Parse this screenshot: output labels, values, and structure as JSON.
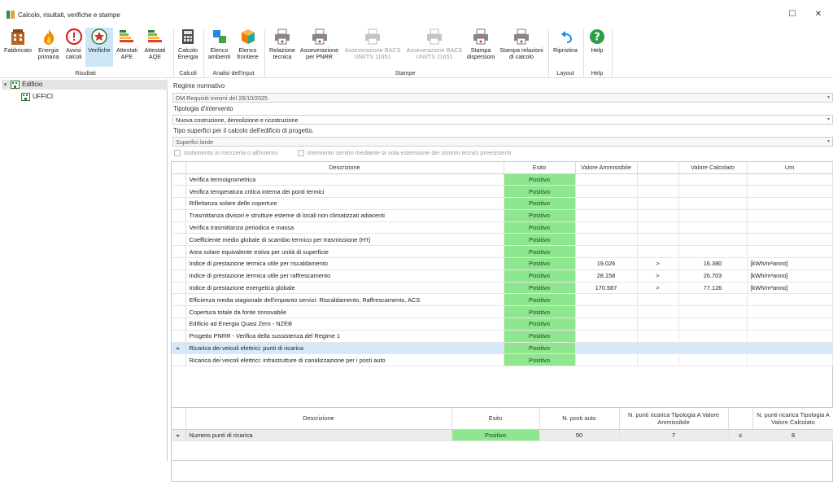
{
  "window": {
    "title": "Calcolo, risultati, verifiche e stampe",
    "minimize_glyph": "☐",
    "close_glyph": "✕"
  },
  "ribbon": {
    "buttons": [
      {
        "label": "Fabbricato",
        "icon": "building-icon"
      },
      {
        "label": "Energia primaria",
        "icon": "fire-icon"
      },
      {
        "label": "Avvisi calcoli",
        "icon": "warning-icon"
      },
      {
        "label": "Verifiche",
        "icon": "emblem-icon"
      },
      {
        "label": "Attestati APE",
        "icon": "energy-class-icon"
      },
      {
        "label": "Attestati AQE",
        "icon": "energy-class-icon"
      },
      {
        "label": "Calcolo Energia",
        "icon": "calculator-icon"
      },
      {
        "label": "Elenco ambienti",
        "icon": "rooms-icon"
      },
      {
        "label": "Elenco frontiere",
        "icon": "cube-icon"
      },
      {
        "label": "Relazione tecnica",
        "icon": "printer-icon"
      },
      {
        "label": "Asseverazione per PNRR",
        "icon": "printer-icon"
      },
      {
        "label": "Asseverazione BACS UNI/TS 11651",
        "icon": "printer-icon"
      },
      {
        "label": "Asseverazione BACS UNI/TS 11651",
        "icon": "printer-icon"
      },
      {
        "label": "Stampa dispersioni",
        "icon": "printer-icon"
      },
      {
        "label": "Stampa relazioni di calcolo",
        "icon": "printer-icon"
      },
      {
        "label": "Ripristina",
        "icon": "undo-icon"
      },
      {
        "label": "Help",
        "icon": "help-icon"
      }
    ],
    "groups": [
      "Risultati",
      "Calcoli",
      "Analisi dell'input",
      "Stampe",
      "Layout",
      "Help"
    ]
  },
  "tree": {
    "root": "Edificio",
    "child": "UFFICI"
  },
  "form": {
    "regime_label": "Regime normativo",
    "regime_value": "DM Requisiti minimi del 28/10/2025",
    "tipologia_label": "Tipologia d'intervento",
    "tipologia_value": "Nuova costruzione, demolizione e ricostruzione",
    "superfici_label": "Tipo superfici per il calcolo dell'edificio di progetto.",
    "superfici_value": "Superfici lorde",
    "check1": "Isolamento in mezzeria o all'interno",
    "check2": "Intervento servito mediante la sola estensione dei sistemi tecnici preesistenti"
  },
  "table1": {
    "headers": [
      "Descrizione",
      "Esito",
      "Valore Ammissibile",
      "Valore Calcolato",
      "Um"
    ],
    "rows": [
      {
        "desc": "Verifica termoigrometrica",
        "esito": "Positivo",
        "amm": "",
        "op": "",
        "calc": "",
        "um": ""
      },
      {
        "desc": "Verifica temperatura critica interna dei ponti termici",
        "esito": "Positivo",
        "amm": "",
        "op": "",
        "calc": "",
        "um": ""
      },
      {
        "desc": "Riflettanza solare delle coperture",
        "esito": "Positivo",
        "amm": "",
        "op": "",
        "calc": "",
        "um": ""
      },
      {
        "desc": "Trasmittanza divisori e strutture esterne di locali non climatizzati adiacenti",
        "esito": "Positivo",
        "amm": "",
        "op": "",
        "calc": "",
        "um": ""
      },
      {
        "desc": "Verifica trasmittanza periodica e massa",
        "esito": "Positivo",
        "amm": "",
        "op": "",
        "calc": "",
        "um": ""
      },
      {
        "desc": "Coefficiente medio globale di scambio termico per trasmissione (H't)",
        "esito": "Positivo",
        "amm": "",
        "op": "",
        "calc": "",
        "um": ""
      },
      {
        "desc": "Area solare equivalente estiva per unità di superficie",
        "esito": "Positivo",
        "amm": "",
        "op": "",
        "calc": "",
        "um": ""
      },
      {
        "desc": "Indice di prestazione termica utile per riscaldamento",
        "esito": "Positivo",
        "amm": "19.026",
        "op": ">",
        "calc": "16.380",
        "um": "[kWh/m²anno]"
      },
      {
        "desc": "Indice di prestazione termica utile per raffrescamento",
        "esito": "Positivo",
        "amm": "28.158",
        "op": ">",
        "calc": "26.703",
        "um": "[kWh/m²anno]"
      },
      {
        "desc": "Indice di prestazione energetica globale",
        "esito": "Positivo",
        "amm": "170.587",
        "op": ">",
        "calc": "77.126",
        "um": "[kWh/m²anno]"
      },
      {
        "desc": "Efficienza media stagionale dell'impianto servizi: Riscaldamento, Raffrescamento, ACS",
        "esito": "Positivo",
        "amm": "",
        "op": "",
        "calc": "",
        "um": ""
      },
      {
        "desc": "Copertura totale da fonte rinnovabile",
        "esito": "Positivo",
        "amm": "",
        "op": "",
        "calc": "",
        "um": ""
      },
      {
        "desc": "Edificio ad Energia Quasi Zero - NZEB",
        "esito": "Positivo",
        "amm": "",
        "op": "",
        "calc": "",
        "um": ""
      },
      {
        "desc": "Progetto PNRR - Verifica della sussistenza del Regime 1",
        "esito": "Positivo",
        "amm": "",
        "op": "",
        "calc": "",
        "um": ""
      },
      {
        "desc": "Ricarica dei veicoli elettrici: punti di ricarica",
        "esito": "Positivo",
        "amm": "",
        "op": "",
        "calc": "",
        "um": "",
        "selected": true
      },
      {
        "desc": "Ricarica dei veicoli elettrici: infrastrutture di canalizzazione per i posti auto",
        "esito": "Positivo",
        "amm": "",
        "op": "",
        "calc": "",
        "um": ""
      }
    ]
  },
  "table2": {
    "headers": [
      "Descrizione",
      "Esito",
      "N. posti auto",
      "N. punti ricarica Tipologia A Valore Ammissibile",
      "N. punti ricarica Tipologia A Valore Calcolato"
    ],
    "row": {
      "desc": "Numero punti di ricarica",
      "esito": "Positivo",
      "posti": "50",
      "amm": "7",
      "op": "≤",
      "calc": "8"
    }
  },
  "row_indicator": "▸",
  "colors": {
    "positive": "#8ee68e",
    "selected_row": "#d7e9f8",
    "ribbon_active": "#cde6f7"
  }
}
